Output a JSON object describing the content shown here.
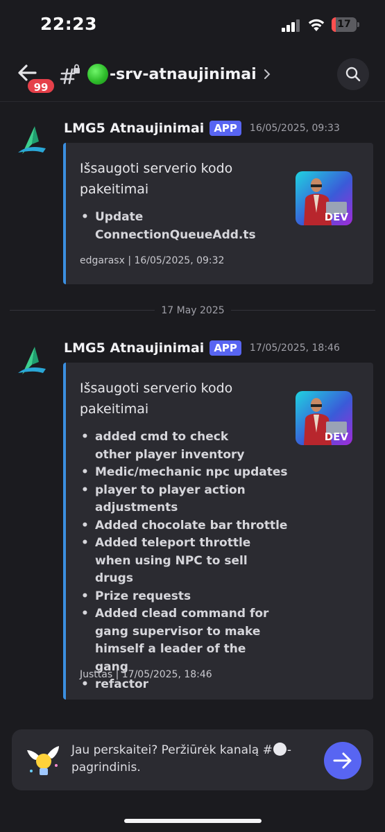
{
  "status_bar": {
    "time": "22:23",
    "battery_level": "17",
    "battery_fraction": 0.17,
    "icons": [
      "signal-icon",
      "wifi-icon",
      "battery-icon"
    ]
  },
  "header": {
    "unread_badge": "99",
    "channel_name": "-srv-atnaujinimai",
    "icons": [
      "back-arrow-icon",
      "locked-channel-icon",
      "green-circle-emoji",
      "chevron-right-icon",
      "search-icon"
    ]
  },
  "messages": [
    {
      "author": "LMG5 Atnaujinimai",
      "badge": "APP",
      "timestamp": "16/05/2025, 09:33",
      "embed": {
        "title": "Išsaugoti serverio kodo pakeitimai",
        "thumbnail_label": "DEV",
        "items": [
          "Update ConnectionQueueAdd.ts"
        ],
        "footer": "edgarasx | 16/05/2025, 09:32"
      }
    },
    {
      "author": "LMG5 Atnaujinimai",
      "badge": "APP",
      "timestamp": "17/05/2025, 18:46",
      "embed": {
        "title": "Išsaugoti serverio kodo pakeitimai",
        "thumbnail_label": "DEV",
        "items": [
          "added cmd to check other player inventory",
          "Medic/mechanic npc updates",
          "player to player action adjustments",
          "Added chocolate bar throttle",
          "Added teleport throttle when using NPC to sell drugs",
          "Prize requests",
          "Added clead command for gang supervisor to make himself a leader of the gang",
          "refactor"
        ],
        "footer": "Justtas | 17/05/2025, 18:46"
      }
    }
  ],
  "date_divider": "17 May 2025",
  "prompt": {
    "text_before": "Jau perskaitei? Peržiūrėk kanalą #",
    "text_after": "-pagrindinis.",
    "icons": [
      "winged-lightbulb-icon",
      "white-circle-emoji",
      "arrow-right-icon"
    ]
  },
  "colors": {
    "background": "#1b1b1f",
    "embed_background": "#2b2b31",
    "embed_accent": "#3b8fe0",
    "app_badge": "#5865f2",
    "unread_badge": "#e5404a",
    "battery_low": "#ff4f4f"
  }
}
